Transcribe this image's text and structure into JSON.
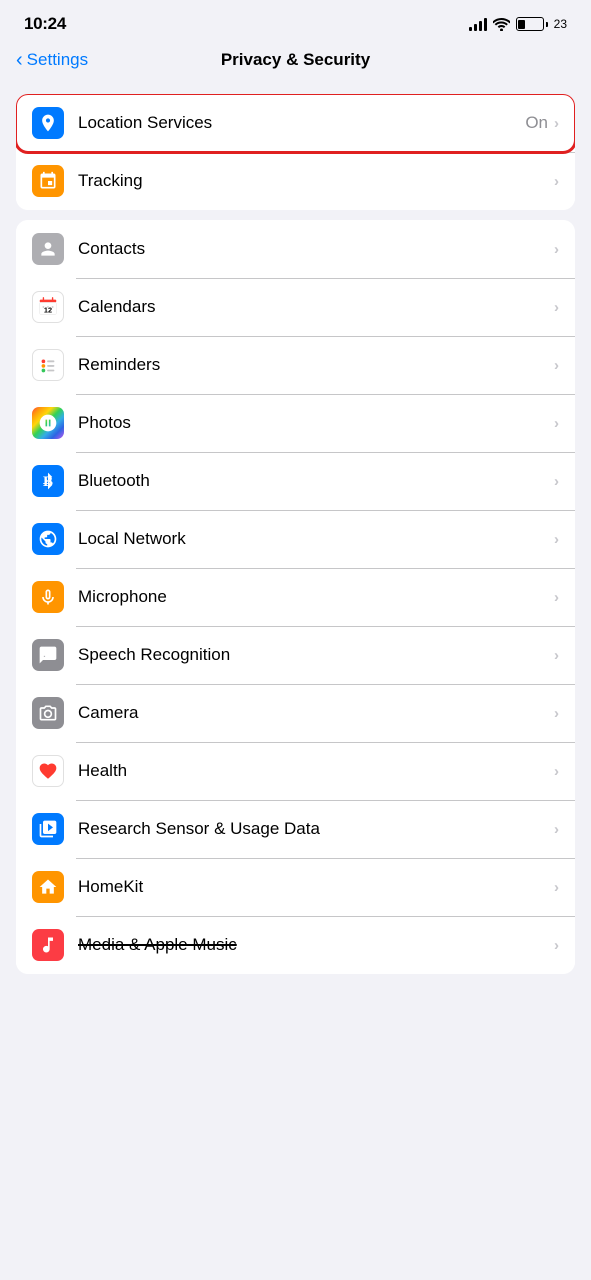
{
  "status": {
    "time": "10:24",
    "battery": "23"
  },
  "nav": {
    "back_label": "Settings",
    "title": "Privacy & Security"
  },
  "group1": {
    "rows": [
      {
        "id": "location-services",
        "label": "Location Services",
        "value": "On",
        "highlighted": true,
        "icon_bg": "blue",
        "icon": "location"
      },
      {
        "id": "tracking",
        "label": "Tracking",
        "value": "",
        "highlighted": false,
        "icon_bg": "orange",
        "icon": "tracking"
      }
    ]
  },
  "group2": {
    "rows": [
      {
        "id": "contacts",
        "label": "Contacts",
        "icon_bg": "gray",
        "icon": "contacts"
      },
      {
        "id": "calendars",
        "label": "Calendars",
        "icon_bg": "red",
        "icon": "calendars"
      },
      {
        "id": "reminders",
        "label": "Reminders",
        "icon_bg": "red",
        "icon": "reminders"
      },
      {
        "id": "photos",
        "label": "Photos",
        "icon_bg": "photos",
        "icon": "photos"
      },
      {
        "id": "bluetooth",
        "label": "Bluetooth",
        "icon_bg": "blue",
        "icon": "bluetooth"
      },
      {
        "id": "local-network",
        "label": "Local Network",
        "icon_bg": "blue",
        "icon": "globe"
      },
      {
        "id": "microphone",
        "label": "Microphone",
        "icon_bg": "orange",
        "icon": "microphone"
      },
      {
        "id": "speech-recognition",
        "label": "Speech Recognition",
        "icon_bg": "gray",
        "icon": "speech"
      },
      {
        "id": "camera",
        "label": "Camera",
        "icon_bg": "gray",
        "icon": "camera"
      },
      {
        "id": "health",
        "label": "Health",
        "icon_bg": "white",
        "icon": "health"
      },
      {
        "id": "research-sensor",
        "label": "Research Sensor & Usage Data",
        "icon_bg": "blue",
        "icon": "research"
      },
      {
        "id": "homekit",
        "label": "HomeKit",
        "icon_bg": "orange",
        "icon": "homekit"
      },
      {
        "id": "media-apple-music",
        "label": "Media & Apple Music",
        "icon_bg": "red",
        "icon": "music",
        "strikethrough": true
      }
    ]
  }
}
